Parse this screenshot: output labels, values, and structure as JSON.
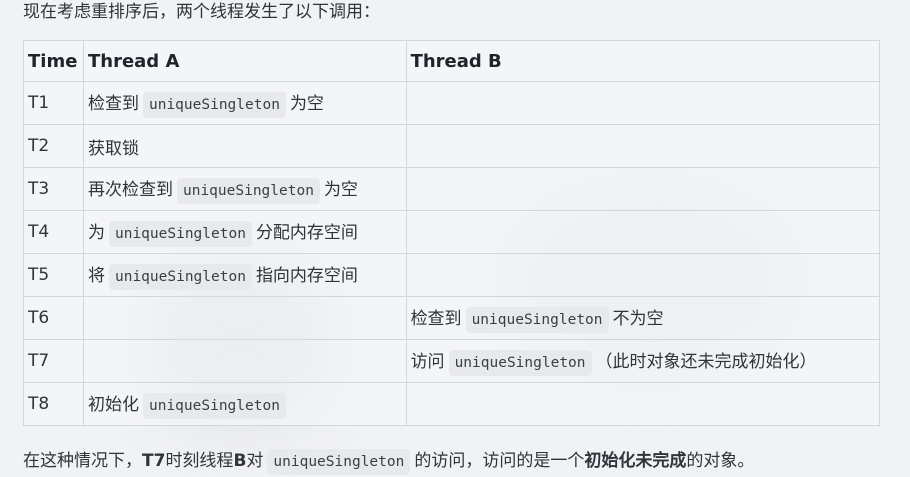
{
  "intro": "现在考虑重排序后，两个线程发生了以下调用：",
  "table": {
    "headers": [
      "Time",
      "Thread A",
      "Thread B"
    ],
    "rows": [
      {
        "time": "T1",
        "a_pre": "检查到",
        "a_code": "uniqueSingleton",
        "a_post": "为空",
        "b_pre": "",
        "b_code": "",
        "b_post": ""
      },
      {
        "time": "T2",
        "a_pre": "获取锁",
        "a_code": "",
        "a_post": "",
        "b_pre": "",
        "b_code": "",
        "b_post": ""
      },
      {
        "time": "T3",
        "a_pre": "再次检查到",
        "a_code": "uniqueSingleton",
        "a_post": "为空",
        "b_pre": "",
        "b_code": "",
        "b_post": ""
      },
      {
        "time": "T4",
        "a_pre": "为",
        "a_code": "uniqueSingleton",
        "a_post": "分配内存空间",
        "b_pre": "",
        "b_code": "",
        "b_post": ""
      },
      {
        "time": "T5",
        "a_pre": "将",
        "a_code": "uniqueSingleton",
        "a_post": "指向内存空间",
        "b_pre": "",
        "b_code": "",
        "b_post": ""
      },
      {
        "time": "T6",
        "a_pre": "",
        "a_code": "",
        "a_post": "",
        "b_pre": "检查到",
        "b_code": "uniqueSingleton",
        "b_post": "不为空"
      },
      {
        "time": "T7",
        "a_pre": "",
        "a_code": "",
        "a_post": "",
        "b_pre": "访问",
        "b_code": "uniqueSingleton",
        "b_post": "（此时对象还未完成初始化）"
      },
      {
        "time": "T8",
        "a_pre": "初始化",
        "a_code": "uniqueSingleton",
        "a_post": "",
        "b_pre": "",
        "b_code": "",
        "b_post": ""
      }
    ]
  },
  "outro": {
    "part1": "在这种情况下，",
    "time_bold": "T7",
    "part2": "时刻线程",
    "thread_bold": "B",
    "part3": "对",
    "code": "uniqueSingleton",
    "part4": "的访问，访问的是一个",
    "emphasis": "初始化未完成",
    "part5": "的对象。"
  }
}
